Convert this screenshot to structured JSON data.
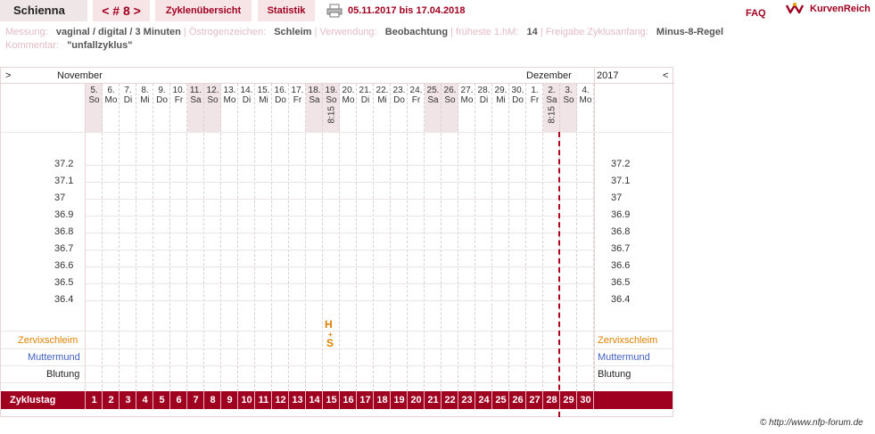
{
  "header": {
    "name": "Schienna",
    "nav": "< # 8 >",
    "overview": "Zyklenübersicht",
    "stats": "Statistik",
    "daterange": "05.11.2017 bis 17.04.2018",
    "faq": "FAQ",
    "logo": "KurvenReich"
  },
  "meta": {
    "messung_label": "Messung:",
    "messung": "vaginal / digital / 3 Minuten",
    "oestrogen_label": "Östrogenzeichen:",
    "oestrogen": "Schleim",
    "verwendung_label": "Verwendung:",
    "verwendung": "Beobachtung",
    "hm_label": "früheste 1.hM:",
    "hm": "14",
    "freigabe_label": "Freigabe Zyklusanfang:",
    "freigabe": "Minus-8-Regel",
    "kommentar_label": "Kommentar:",
    "kommentar": "\"unfallzyklus\""
  },
  "chart": {
    "left_arrow": ">",
    "right_arrow": "<",
    "month_start": "November",
    "month_end": "Dezember",
    "year": "2017",
    "temps": [
      "37.2",
      "37.1",
      "37",
      "36.9",
      "36.8",
      "36.7",
      "36.6",
      "36.5",
      "36.4"
    ],
    "rows": {
      "zervix": "Zervixschleim",
      "muttermund": "Muttermund",
      "blutung": "Blutung",
      "zyklustag": "Zyklustag"
    },
    "marks": {
      "h": "H",
      "s": "S",
      "plus": "+"
    },
    "days": [
      {
        "d": "5.",
        "w": "So",
        "we": true
      },
      {
        "d": "6.",
        "w": "Mo"
      },
      {
        "d": "7.",
        "w": "Di"
      },
      {
        "d": "8.",
        "w": "Mi"
      },
      {
        "d": "9.",
        "w": "Do"
      },
      {
        "d": "10.",
        "w": "Fr"
      },
      {
        "d": "11.",
        "w": "Sa",
        "we": true
      },
      {
        "d": "12.",
        "w": "So",
        "we": true
      },
      {
        "d": "13.",
        "w": "Mo"
      },
      {
        "d": "14.",
        "w": "Di"
      },
      {
        "d": "15.",
        "w": "Mi"
      },
      {
        "d": "16.",
        "w": "Do"
      },
      {
        "d": "17.",
        "w": "Fr"
      },
      {
        "d": "18.",
        "w": "Sa",
        "we": true,
        "time": ""
      },
      {
        "d": "19.",
        "w": "So",
        "we": true,
        "time": "8:15"
      },
      {
        "d": "20.",
        "w": "Mo"
      },
      {
        "d": "21.",
        "w": "Di"
      },
      {
        "d": "22.",
        "w": "Mi"
      },
      {
        "d": "23.",
        "w": "Do"
      },
      {
        "d": "24.",
        "w": "Fr"
      },
      {
        "d": "25.",
        "w": "Sa",
        "we": true
      },
      {
        "d": "26.",
        "w": "So",
        "we": true
      },
      {
        "d": "27.",
        "w": "Mo"
      },
      {
        "d": "28.",
        "w": "Di"
      },
      {
        "d": "29.",
        "w": "Mi"
      },
      {
        "d": "30.",
        "w": "Do"
      },
      {
        "d": "1.",
        "w": "Fr"
      },
      {
        "d": "2.",
        "w": "Sa",
        "we": true,
        "time": "8:15"
      },
      {
        "d": "3.",
        "w": "So",
        "we": true
      },
      {
        "d": "4.",
        "w": "Mo"
      }
    ],
    "cycle_days": [
      "1",
      "2",
      "3",
      "4",
      "5",
      "6",
      "7",
      "8",
      "9",
      "10",
      "11",
      "12",
      "13",
      "14",
      "15",
      "16",
      "17",
      "18",
      "19",
      "20",
      "21",
      "22",
      "23",
      "24",
      "25",
      "26",
      "27",
      "28",
      "29",
      "30"
    ]
  },
  "copyright": "© http://www.nfp-forum.de",
  "colors": {
    "accent": "#a00020",
    "weekend": "#f1e4e6",
    "muttermund": "#4060c0",
    "zervix": "#e08000"
  }
}
